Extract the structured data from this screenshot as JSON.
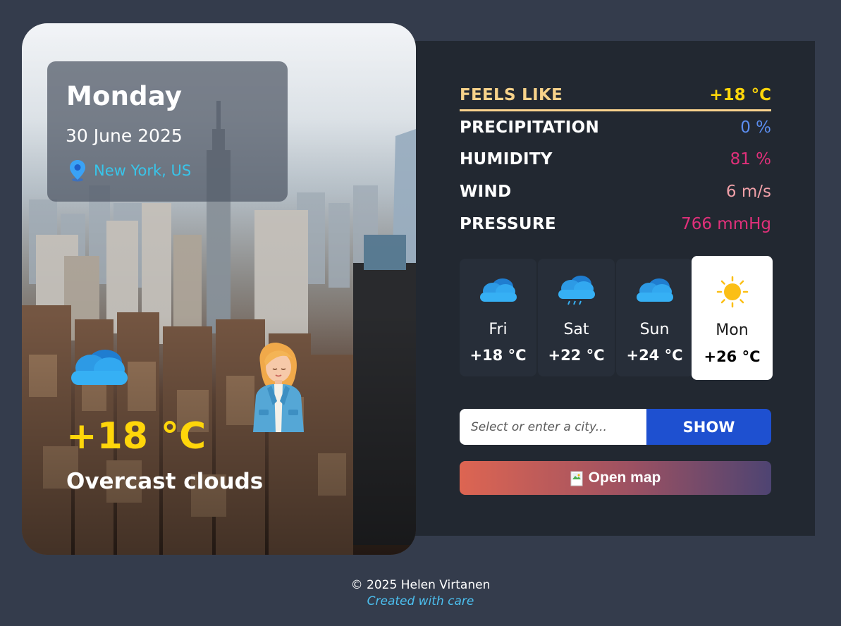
{
  "current": {
    "day": "Monday",
    "date": "30 June 2025",
    "location": "New York, US",
    "temperature": "+18 °C",
    "description": "Overcast clouds",
    "icon": "cloud-icon"
  },
  "details": [
    {
      "label": "FEELS LIKE",
      "value": "+18 °C",
      "color": "#ffd60a"
    },
    {
      "label": "PRECIPITATION",
      "value": "0 %",
      "color": "#5b8def"
    },
    {
      "label": "HUMIDITY",
      "value": "81 %",
      "color": "#e0307a"
    },
    {
      "label": "WIND",
      "value": "6 m/s",
      "color": "#f0a0a8"
    },
    {
      "label": "PRESSURE",
      "value": "766 mmHg",
      "color": "#e0307a"
    }
  ],
  "forecast": [
    {
      "day": "Fri",
      "temp": "+18 °C",
      "icon": "cloud-icon",
      "selected": false
    },
    {
      "day": "Sat",
      "temp": "+22 °C",
      "icon": "rain-cloud-icon",
      "selected": false
    },
    {
      "day": "Sun",
      "temp": "+24 °C",
      "icon": "cloud-icon",
      "selected": false
    },
    {
      "day": "Mon",
      "temp": "+26 °C",
      "icon": "sun-icon",
      "selected": true
    }
  ],
  "search": {
    "placeholder": "Select or enter a city...",
    "button_label": "SHOW"
  },
  "map_button": {
    "label": "Open map"
  },
  "footer": {
    "copyright": "© 2025 Helen Virtanen",
    "tagline": "Created with care"
  },
  "colors": {
    "background": "#343c4c",
    "panel": "#222831",
    "accent_yellow": "#ffd60a",
    "accent_blue": "#1e50d0",
    "location_cyan": "#38c5ea"
  }
}
